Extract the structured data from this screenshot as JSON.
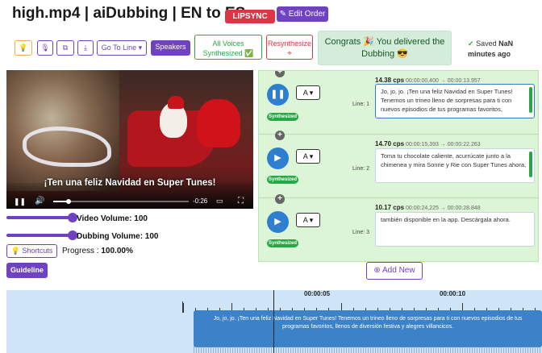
{
  "header": {
    "title": "high.mp4 | aiDubbing | EN to ES",
    "lipsync_badge": "LIPSYNC",
    "edit_order_label": "Edit Order"
  },
  "toolbar": {
    "goto_line_label": "Go To Line",
    "speakers_label": "Speakers",
    "all_voices_line1": "All Voices",
    "all_voices_line2": "Synthesized",
    "resynthesize_label": "Resynthesize",
    "congrats_line1": "Congrats 🎉  You delivered the",
    "congrats_line2": "Dubbing 😎",
    "saved_line1": "Saved",
    "saved_value": "NaN",
    "saved_line2": "minutes ago"
  },
  "video": {
    "subtitle": "¡Ten una feliz Navidad en Super Tunes!",
    "time_remaining": "-0:26"
  },
  "volumes": {
    "video_label": "Video Volume: 100",
    "dubbing_label": "Dubbing Volume: 100",
    "video_value": 1.0,
    "dubbing_value": 1.0
  },
  "controls": {
    "shortcuts_label": "Shortcuts",
    "progress_label": "Progress : ",
    "progress_value": "100.00%",
    "guideline_label": "Guideline"
  },
  "lines": [
    {
      "line_label": "Line: 1",
      "cps": "14.38 cps",
      "timing": "00:00:00,400 → 00:00:13.957",
      "speaker": "A",
      "status": "Synthesized",
      "text": "Jo, jo, jo. ¡Ten una feliz Navidad en Super Tunes! Tenemos un trineo lleno de sorpresas para ti con nuevos episodios de tus programas favoritos,",
      "playing": true
    },
    {
      "line_label": "Line: 2",
      "cps": "14.70 cps",
      "timing": "00:00:15,393 → 00:00:22.263",
      "speaker": "A",
      "status": "Synthesized",
      "text": "Toma tu chocolate caliente, acurrúcate junto a la chimenea y mira Sonrie y Rie con Super Tunes ahora,",
      "playing": false
    },
    {
      "line_label": "Line: 3",
      "cps": "10.17 cps",
      "timing": "00:00:24,225 → 00:00:28.848",
      "speaker": "A",
      "status": "Synthesized",
      "text": "también disponible en la app. Descárgala ahora.",
      "playing": false
    }
  ],
  "add_new_label": "Add New",
  "timeline": {
    "label_5s": "00:00:05",
    "label_10s": "00:00:10",
    "clip_text": "Jo, jo, jo. ¡Ten una feliz Navidad en Super Tunes! Tenemos un trineo lleno de sorpresas para ti con nuevos episodios de tus programas favoritos, llenos de diversión festiva y alegres villancicos."
  },
  "colors": {
    "accent": "#6f42c1",
    "danger": "#dc3545",
    "success": "#28a745",
    "play_blue": "#2f7fd1",
    "lines_bg": "#dcf5d6",
    "timeline_bg": "#cfe4f7"
  }
}
